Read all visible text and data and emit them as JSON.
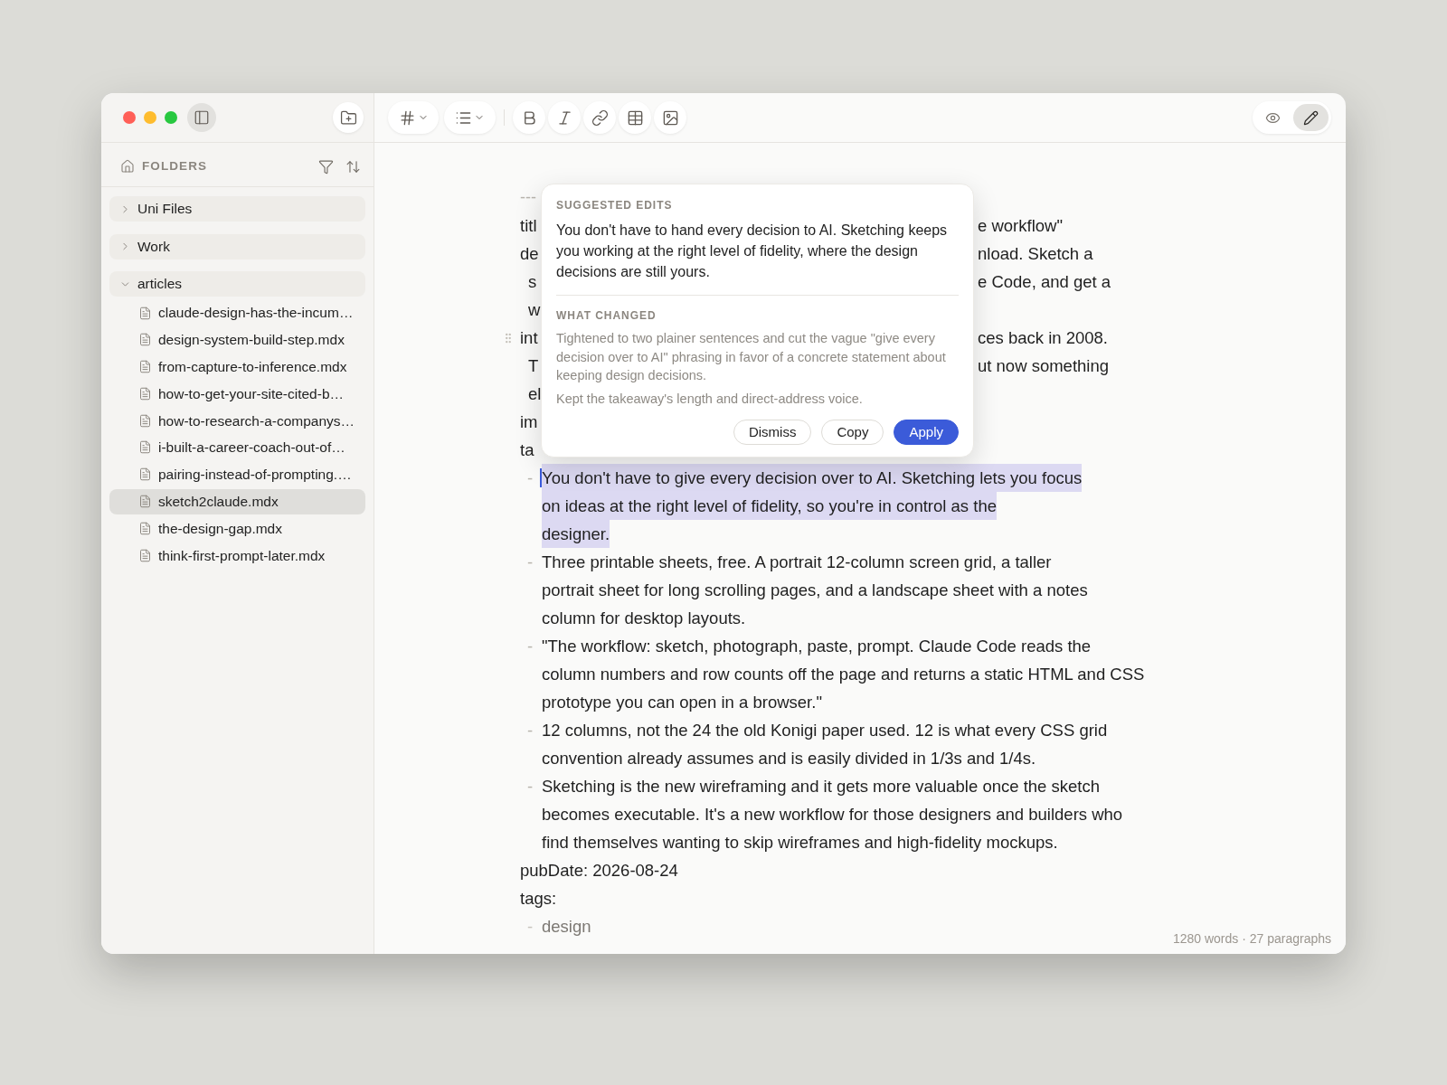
{
  "window": {
    "sidebar_toggle": {
      "on": true
    },
    "view_modes": [
      {
        "kind": "preview",
        "selected": false
      },
      {
        "kind": "edit",
        "selected": true
      }
    ]
  },
  "sidebar": {
    "header": "FOLDERS",
    "folders": [
      {
        "label": "Uni Files",
        "expanded": false
      },
      {
        "label": "Work",
        "expanded": false
      },
      {
        "label": "articles",
        "expanded": true,
        "children": [
          {
            "label": "claude-design-has-the-incum…",
            "selected": false
          },
          {
            "label": "design-system-build-step.mdx",
            "selected": false
          },
          {
            "label": "from-capture-to-inference.mdx",
            "selected": false
          },
          {
            "label": "how-to-get-your-site-cited-b…",
            "selected": false
          },
          {
            "label": "how-to-research-a-companys…",
            "selected": false
          },
          {
            "label": "i-built-a-career-coach-out-of…",
            "selected": false
          },
          {
            "label": "pairing-instead-of-prompting.…",
            "selected": false
          },
          {
            "label": "sketch2claude.mdx",
            "selected": true
          },
          {
            "label": "the-design-gap.mdx",
            "selected": false
          },
          {
            "label": "think-first-prompt-later.mdx",
            "selected": false
          }
        ]
      }
    ]
  },
  "editor": {
    "lines": [
      {
        "kind": "rule",
        "text": "---"
      },
      {
        "kind": "key",
        "left": "titl",
        "right": "e workflow\""
      },
      {
        "kind": "key",
        "left": "de",
        "right": "nload. Sketch a"
      },
      {
        "kind": "cont",
        "left": "s",
        "right": "e Code, and get a"
      },
      {
        "kind": "cont",
        "left": "w"
      },
      {
        "kind": "key",
        "left": "int",
        "right": "ces back in 2008.",
        "drag_handle": true
      },
      {
        "kind": "cont",
        "left": "T",
        "right": "ut now something"
      },
      {
        "kind": "cont",
        "left": "el"
      },
      {
        "kind": "key",
        "left": "im"
      },
      {
        "kind": "key",
        "left": "ta"
      },
      {
        "kind": "item",
        "marker": "-",
        "text": "You don't have to give every decision over to AI. Sketching lets you focus\non ideas at the right level of fidelity, so you're in control as the\ndesigner.",
        "highlighted": true,
        "caret": true
      },
      {
        "kind": "item",
        "marker": "-",
        "text": "Three printable sheets, free. A portrait 12-column screen grid, a taller\nportrait sheet for long scrolling pages, and a landscape sheet with a notes\ncolumn for desktop layouts.",
        "highlighted": false,
        "caret": false
      },
      {
        "kind": "item",
        "marker": "-",
        "text": "\"The workflow: sketch, photograph, paste, prompt. Claude Code reads the\ncolumn numbers and row counts off the page and returns a static HTML and CSS\nprototype you can open in a browser.\"",
        "highlighted": false,
        "caret": false
      },
      {
        "kind": "item",
        "marker": "-",
        "text": "12 columns, not the 24 the old Konigi paper used. 12 is what every CSS grid\nconvention already assumes and is easily divided in 1/3s and 1/4s.",
        "highlighted": false,
        "caret": false
      },
      {
        "kind": "item",
        "marker": "-",
        "text": "Sketching is the new wireframing and it gets more valuable once the sketch\nbecomes executable. It's a new workflow for those designers and builders who\nfind themselves wanting to skip wireframes and high-fidelity mockups.",
        "highlighted": false,
        "caret": false
      },
      {
        "kind": "key",
        "left": "pubDate: 2026-08-24"
      },
      {
        "kind": "key",
        "left": "tags:"
      },
      {
        "kind": "tag",
        "marker": "-",
        "text": "design"
      }
    ],
    "status": "1280 words · 27 paragraphs"
  },
  "popup": {
    "heading": "SUGGESTED EDITS",
    "suggestion": "You don't have to hand every decision to AI. Sketching keeps you working at the right level of fidelity, where the design decisions are still yours.",
    "changes_heading": "WHAT CHANGED",
    "changes": [
      "Tightened to two plainer sentences and cut the vague \"give every decision over to AI\" phrasing in favor of a concrete statement about keeping design decisions.",
      "Kept the takeaway's length and direct-address voice."
    ],
    "buttons": [
      {
        "label": "Dismiss",
        "kind": "secondary"
      },
      {
        "label": "Copy",
        "kind": "secondary"
      },
      {
        "label": "Apply",
        "kind": "primary"
      }
    ]
  }
}
